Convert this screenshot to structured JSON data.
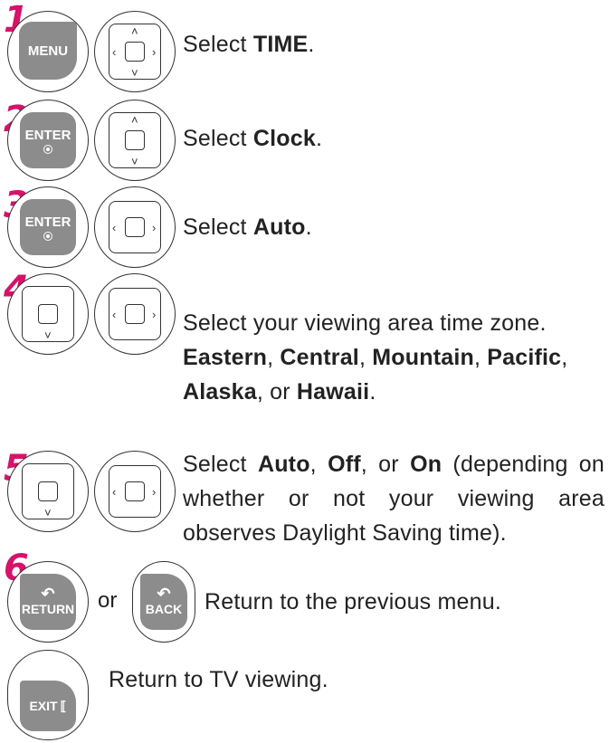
{
  "steps": [
    {
      "number": "1",
      "key_label": "MENU",
      "text_prefix": "Select ",
      "text_bold": "TIME",
      "text_suffix": "."
    },
    {
      "number": "2",
      "key_label": "ENTER",
      "text_prefix": "Select ",
      "text_bold": "Clock",
      "text_suffix": "."
    },
    {
      "number": "3",
      "key_label": "ENTER",
      "text_prefix": "Select ",
      "text_bold": "Auto",
      "text_suffix": "."
    },
    {
      "number": "4",
      "line1": "Select your viewing area time zone.",
      "zones": [
        "Eastern",
        "Central",
        "Mountain",
        "Pacific",
        "Alaska",
        "Hawaii"
      ],
      "sep": ", ",
      "or_word": ", or ",
      "end": "."
    },
    {
      "number": "5",
      "pre": "Select ",
      "opt1": "Auto",
      "opt2": "Off",
      "opt3": "On",
      "after": " (depending on whether or not your viewing area observes Daylight Saving time)."
    },
    {
      "number": "6",
      "key1_label": "RETURN",
      "or_text": "or",
      "key2_label": "BACK",
      "text": "Return to the previous menu."
    }
  ],
  "exit": {
    "key_label": "EXIT",
    "text": "Return to TV viewing."
  },
  "colors": {
    "accent": "#d6126a",
    "key": "#8c8c8c"
  }
}
